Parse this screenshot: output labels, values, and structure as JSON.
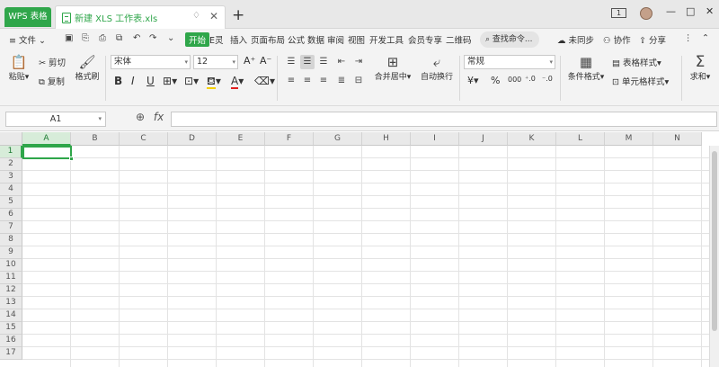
{
  "titlebar": {
    "app_tab": "WPS 表格",
    "doc_tab": "新建 XLS 工作表.xls",
    "pin_glyph": "♢",
    "close_glyph": "✕",
    "new_tab_glyph": "+",
    "badge_text": "1"
  },
  "menubar": {
    "file": "≡ 文件 ⌄",
    "tabs": [
      "开始",
      "E灵",
      "插入",
      "页面布局",
      "公式",
      "数据",
      "审阅",
      "视图",
      "开发工具",
      "会员专享",
      "二维码"
    ],
    "search": "查找命令...",
    "sync": "未同步",
    "collab": "协作",
    "share": "分享"
  },
  "ribbon": {
    "paste": "粘贴",
    "cut": "剪切",
    "copy": "复制",
    "format_painter": "格式刷",
    "font": "宋体",
    "font_size": "12",
    "grow_font": "A⁺",
    "shrink_font": "A⁻",
    "bold": "B",
    "italic": "I",
    "underline": "U",
    "merge_center": "合并居中",
    "wrap_text": "自动换行",
    "number_format": "常规",
    "currency": "¥",
    "percent": "%",
    "thousands": "000",
    "inc_decimal": "⁺.0",
    "dec_decimal": "⁻.0",
    "cond_format": "条件格式",
    "table_style": "表格样式",
    "cell_style": "单元格样式",
    "sum": "求和"
  },
  "formula": {
    "name_box": "A1",
    "fx": "fx",
    "value": ""
  },
  "grid": {
    "columns": [
      "A",
      "B",
      "C",
      "D",
      "E",
      "F",
      "G",
      "H",
      "I",
      "J",
      "K",
      "L",
      "M",
      "N"
    ],
    "rows": [
      "1",
      "2",
      "3",
      "4",
      "5",
      "6",
      "7",
      "8",
      "9",
      "10",
      "11",
      "12",
      "13",
      "14",
      "15",
      "16",
      "17"
    ]
  },
  "colors": {
    "accent": "#2fa64a"
  }
}
